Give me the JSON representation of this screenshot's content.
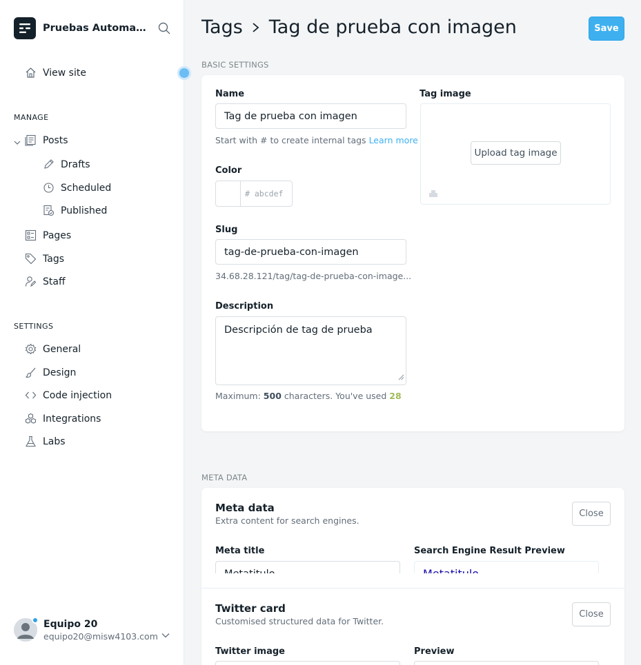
{
  "sidebar": {
    "brand_title": "Pruebas Automatizadas",
    "view_site": "View site",
    "manage_label": "MANAGE",
    "posts": "Posts",
    "drafts": "Drafts",
    "scheduled": "Scheduled",
    "published": "Published",
    "pages": "Pages",
    "tags": "Tags",
    "staff": "Staff",
    "settings_label": "SETTINGS",
    "general": "General",
    "design": "Design",
    "code_injection": "Code injection",
    "integrations": "Integrations",
    "labs": "Labs",
    "user_name": "Equipo 20",
    "user_email": "equipo20@misw4103.com"
  },
  "header": {
    "crumb_parent": "Tags",
    "crumb_current": "Tag de prueba con imagen",
    "save_label": "Save"
  },
  "basic": {
    "group_label": "BASIC SETTINGS",
    "name_label": "Name",
    "name_value": "Tag de prueba con imagen",
    "name_hint": "Start with # to create internal tags",
    "learn_more": "Learn more",
    "color_label": "Color",
    "color_hash": "#",
    "color_placeholder": "abcdef",
    "slug_label": "Slug",
    "slug_value": "tag-de-prueba-con-imagen",
    "slug_url": "34.68.28.121/tag/tag-de-prueba-con-image...",
    "description_label": "Description",
    "description_value": "Descripción de tag de prueba",
    "max_prefix": "Maximum:",
    "max_value": "500",
    "used_prefix": "characters. You've used",
    "used_value": "28",
    "tag_image_label": "Tag image",
    "upload_label": "Upload tag image"
  },
  "meta": {
    "group_label": "META DATA",
    "title": "Meta data",
    "subtitle": "Extra content for search engines.",
    "close_label": "Close",
    "meta_title_label": "Meta title",
    "meta_title_value": "Metatitulo",
    "serp_label": "Search Engine Result Preview",
    "serp_title": "Metatitulo"
  },
  "twitter": {
    "title": "Twitter card",
    "subtitle": "Customised structured data for Twitter.",
    "close_label": "Close",
    "image_label": "Twitter image",
    "preview_label": "Preview"
  },
  "colors": {
    "accent": "#3eb0ef",
    "used_count": "#9fbb58",
    "text": "#15212a"
  }
}
